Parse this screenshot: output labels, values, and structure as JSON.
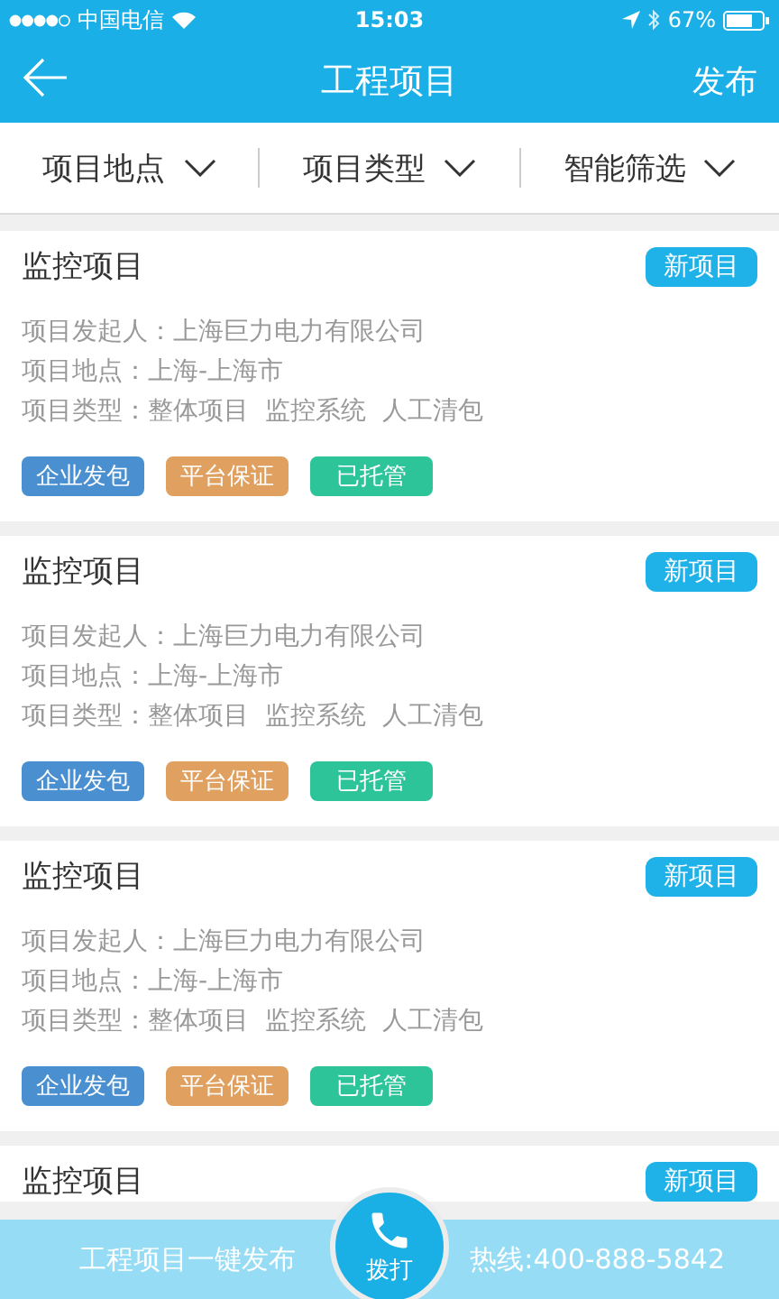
{
  "status_bar": {
    "carrier": "中国电信",
    "time": "15:03",
    "battery": "67%"
  },
  "nav": {
    "title": "工程项目",
    "action": "发布"
  },
  "filters": [
    {
      "label": "项目地点"
    },
    {
      "label": "项目类型"
    },
    {
      "label": "智能筛选"
    }
  ],
  "projects": [
    {
      "title": "监控项目",
      "badge": "新项目",
      "lines": [
        "项目发起人：上海巨力电力有限公司",
        "项目地点：上海-上海市",
        "项目类型：整体项目  监控系统  人工清包"
      ],
      "tags": [
        {
          "label": "企业发包",
          "color": "#4a90d0"
        },
        {
          "label": "平台保证",
          "color": "#e0a060"
        },
        {
          "label": "已托管",
          "color": "#2ec49a"
        }
      ]
    },
    {
      "title": "监控项目",
      "badge": "新项目",
      "lines": [
        "项目发起人：上海巨力电力有限公司",
        "项目地点：上海-上海市",
        "项目类型：整体项目  监控系统  人工清包"
      ],
      "tags": [
        {
          "label": "企业发包",
          "color": "#4a90d0"
        },
        {
          "label": "平台保证",
          "color": "#e0a060"
        },
        {
          "label": "已托管",
          "color": "#2ec49a"
        }
      ]
    },
    {
      "title": "监控项目",
      "badge": "新项目",
      "lines": [
        "项目发起人：上海巨力电力有限公司",
        "项目地点：上海-上海市",
        "项目类型：整体项目  监控系统  人工清包"
      ],
      "tags": [
        {
          "label": "企业发包",
          "color": "#4a90d0"
        },
        {
          "label": "平台保证",
          "color": "#e0a060"
        },
        {
          "label": "已托管",
          "color": "#2ec49a"
        }
      ]
    },
    {
      "title": "监控项目",
      "badge": "新项目"
    }
  ],
  "bottom_bar": {
    "publish": "工程项目一键发布",
    "call": "拨打",
    "hotline": "热线:400-888-5842"
  }
}
